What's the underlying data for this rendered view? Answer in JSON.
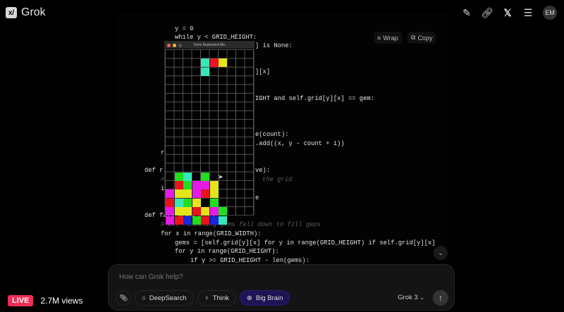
{
  "app": {
    "name": "Grok",
    "logo_icon": "grok-logo"
  },
  "header": {
    "icons": [
      "edit-icon",
      "link-icon",
      "x-icon",
      "search-list-icon"
    ],
    "avatar": "EM"
  },
  "code": {
    "wrap_label": "Wrap",
    "copy_label": "Copy",
    "lines": [
      {
        "t": "y = 0"
      },
      {
        "t": "while y < GRID_HEIGHT:"
      },
      {
        "t": "] is None:"
      },
      {
        "t": "][x]"
      },
      {
        "t": "IGHT and self.grid[y][x] == gem:"
      },
      {
        "t": "e(count):"
      },
      {
        "t": ".add((x, y - count + i))"
      },
      {
        "t": "r"
      },
      {
        "t": "def r"
      },
      {
        "t": "ve):"
      },
      {
        "t": "# "
      },
      {
        "t": "the grid"
      },
      {
        "t": "i"
      },
      {
        "t": "e"
      },
      {
        "t": "def fall_gems(self):"
      },
      {
        "t": "# Let remaining gems fall down to fill gaps"
      },
      {
        "t": "for x in range(GRID_WIDTH):"
      },
      {
        "t": "gems = [self.grid[y][x] for y in range(GRID_HEIGHT) if self.grid[y][x]"
      },
      {
        "t": "for y in range(GRID_HEIGHT):"
      },
      {
        "t": "if y >= GRID_HEIGHT - len(gems):"
      }
    ]
  },
  "game": {
    "title": "Tetris Bejeweled Mix",
    "colors": {
      "R": "#e8131c",
      "G": "#22dc1e",
      "C": "#36e8b8",
      "Y": "#e4e41a",
      "M": "#e61ae6",
      "B": "#1a26d8",
      "K": "#000000"
    },
    "cols": 10,
    "rows": 19,
    "board": [
      "..........",
      "....CRY...",
      "....C.....",
      "..........",
      "..........",
      "..........",
      "..........",
      "..........",
      "..........",
      "..........",
      "..........",
      "..........",
      "..........",
      "..........",
      ".GC.G.....",
      ".RGMMY....",
      "MYYMRY....",
      "RCGYKG....",
      "MYYRYMG...",
      "MRBGRBC..."
    ]
  },
  "composer": {
    "placeholder": "How can Grok help?",
    "deepsearch": "DeepSearch",
    "think": "Think",
    "bigbrain": "Big Brain",
    "model": "Grok 3"
  },
  "live": {
    "badge": "LIVE",
    "views": "2.7M views"
  }
}
